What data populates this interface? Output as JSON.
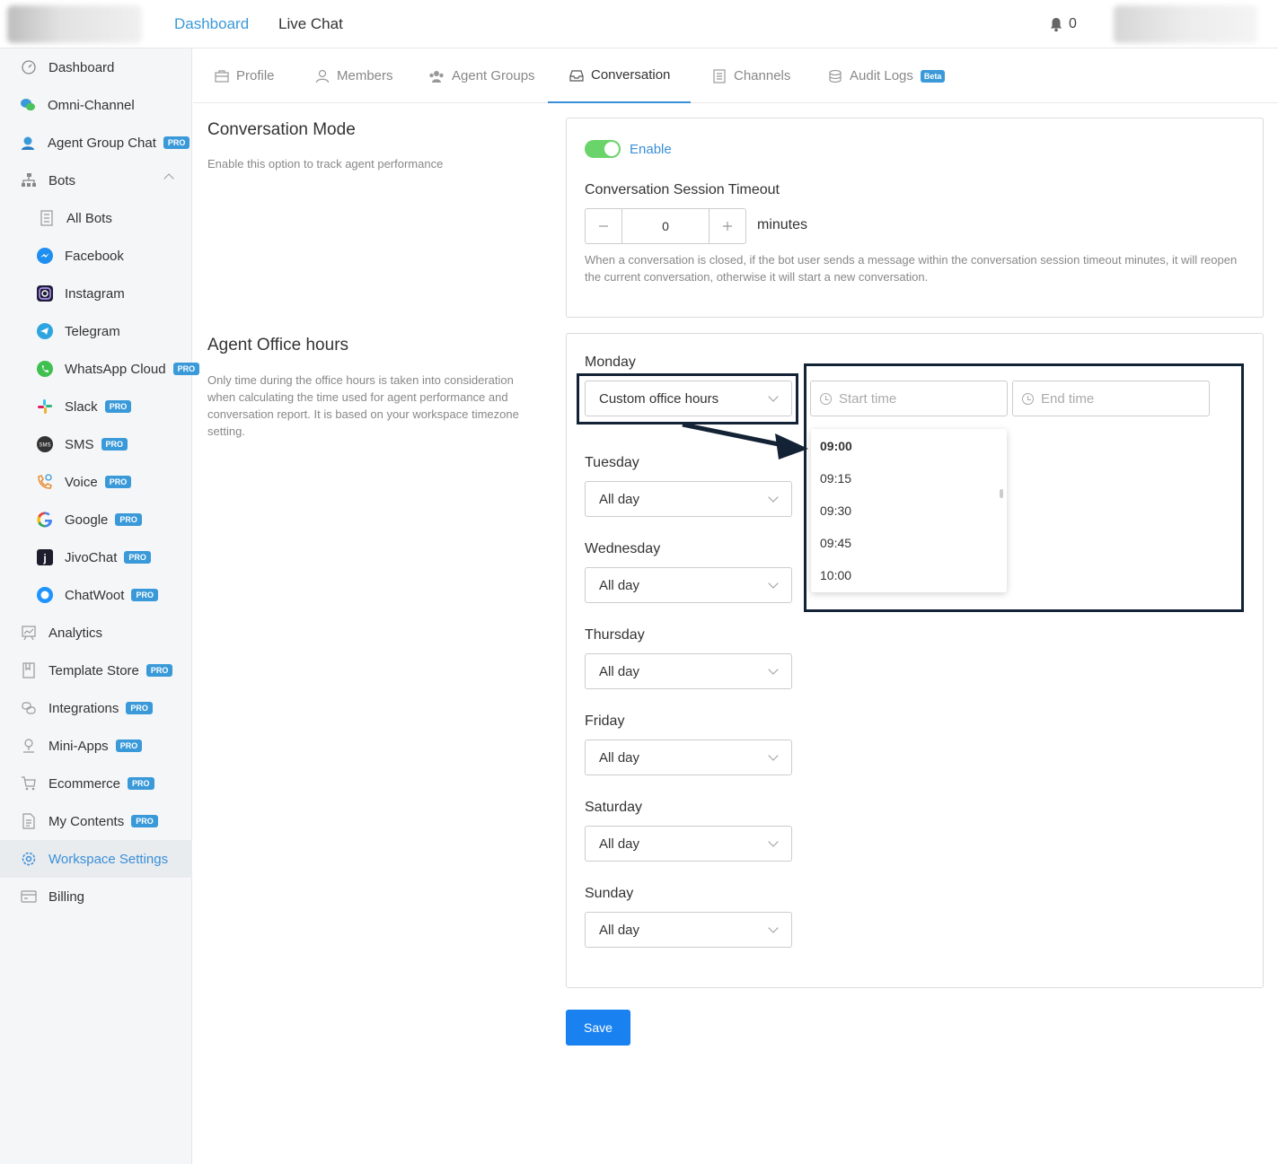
{
  "topbar": {
    "nav_dashboard": "Dashboard",
    "nav_livechat": "Live Chat",
    "notification_count": "0"
  },
  "sidebar": {
    "items": [
      {
        "label": "Dashboard",
        "icon": "dashboard-icon"
      },
      {
        "label": "Omni-Channel",
        "icon": "chat-bubbles-icon"
      },
      {
        "label": "Agent Group Chat",
        "icon": "headset-icon",
        "badge": "PRO"
      },
      {
        "label": "Bots",
        "icon": "sitemap-icon"
      },
      {
        "label": "All Bots",
        "icon": "list-icon"
      },
      {
        "label": "Facebook",
        "icon": "messenger-icon"
      },
      {
        "label": "Instagram",
        "icon": "instagram-icon"
      },
      {
        "label": "Telegram",
        "icon": "telegram-icon"
      },
      {
        "label": "WhatsApp Cloud",
        "icon": "whatsapp-icon",
        "badge": "PRO"
      },
      {
        "label": "Slack",
        "icon": "slack-icon",
        "badge": "PRO"
      },
      {
        "label": "SMS",
        "icon": "sms-icon",
        "badge": "PRO"
      },
      {
        "label": "Voice",
        "icon": "phone-icon",
        "badge": "PRO"
      },
      {
        "label": "Google",
        "icon": "google-icon",
        "badge": "PRO"
      },
      {
        "label": "JivoChat",
        "icon": "jivochat-icon",
        "badge": "PRO"
      },
      {
        "label": "ChatWoot",
        "icon": "chatwoot-icon",
        "badge": "PRO"
      },
      {
        "label": "Analytics",
        "icon": "analytics-icon"
      },
      {
        "label": "Template Store",
        "icon": "template-icon",
        "badge": "PRO"
      },
      {
        "label": "Integrations",
        "icon": "integrations-icon",
        "badge": "PRO"
      },
      {
        "label": "Mini-Apps",
        "icon": "mini-apps-icon",
        "badge": "PRO"
      },
      {
        "label": "Ecommerce",
        "icon": "cart-icon",
        "badge": "PRO"
      },
      {
        "label": "My Contents",
        "icon": "document-icon",
        "badge": "PRO"
      },
      {
        "label": "Workspace Settings",
        "icon": "gear-icon"
      },
      {
        "label": "Billing",
        "icon": "billing-icon"
      }
    ]
  },
  "tabs": [
    {
      "label": "Profile"
    },
    {
      "label": "Members"
    },
    {
      "label": "Agent Groups"
    },
    {
      "label": "Conversation"
    },
    {
      "label": "Channels"
    },
    {
      "label": "Audit Logs",
      "badge": "Beta"
    }
  ],
  "conversation_mode": {
    "title": "Conversation Mode",
    "description": "Enable this option to track agent performance",
    "enabled": true,
    "enable_label": "Enable",
    "timeout_label": "Conversation Session Timeout",
    "timeout_value": "0",
    "timeout_unit": "minutes",
    "note": "When a conversation is closed, if the bot user sends a message within the conversation session timeout minutes, it will reopen the current conversation, otherwise it will start a new conversation."
  },
  "office_hours": {
    "title": "Agent Office hours",
    "description": "Only time during the office hours is taken into consideration when calculating the time used for agent performance and conversation report. It is based on your workspace timezone setting.",
    "start_placeholder": "Start time",
    "end_placeholder": "End time",
    "days": [
      {
        "label": "Monday",
        "value": "Custom office hours"
      },
      {
        "label": "Tuesday",
        "value": "All day"
      },
      {
        "label": "Wednesday",
        "value": "All day"
      },
      {
        "label": "Thursday",
        "value": "All day"
      },
      {
        "label": "Friday",
        "value": "All day"
      },
      {
        "label": "Saturday",
        "value": "All day"
      },
      {
        "label": "Sunday",
        "value": "All day"
      }
    ],
    "time_options": [
      "09:00",
      "09:15",
      "09:30",
      "09:45",
      "10:00"
    ]
  },
  "save_label": "Save",
  "colors": {
    "accent": "#3a8fd9",
    "save_button": "#1a82f0",
    "toggle_on": "#6ad46a",
    "pro_badge": "#3a9ad9",
    "annotation": "#132235"
  }
}
